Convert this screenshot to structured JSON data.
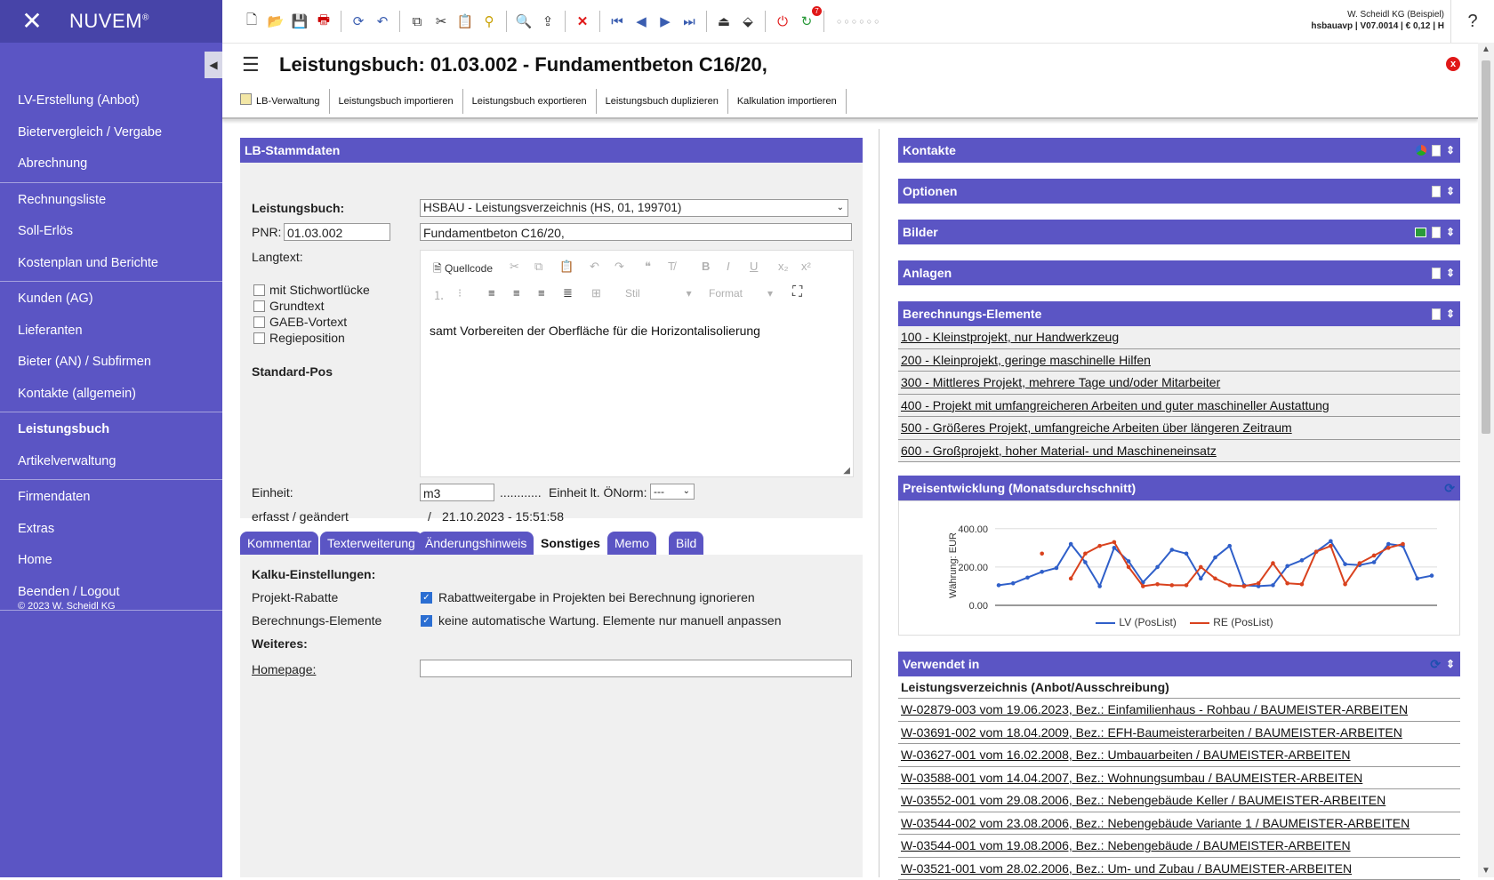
{
  "brand": {
    "name": "NUVEM",
    "reg": "®"
  },
  "sidebar": {
    "groups": [
      [
        "LV-Erstellung (Anbot)",
        "Bietervergleich / Vergabe",
        "Abrechnung"
      ],
      [
        "Rechnungsliste",
        "Soll-Erlös",
        "Kostenplan und Berichte"
      ],
      [
        "Kunden (AG)",
        "Lieferanten",
        "Bieter (AN) / Subfirmen",
        "Kontakte (allgemein)"
      ],
      [
        "Leistungsbuch",
        "Artikelverwaltung"
      ],
      [
        "Firmendaten",
        "Extras",
        "Home",
        "Beenden / Logout"
      ]
    ],
    "active": "Leistungsbuch",
    "copyright": "© 2023 W. Scheidl KG"
  },
  "topbar": {
    "user_line1": "W. Scheidl KG (Beispiel)",
    "user_line2": "hsbauavp | V07.0014 | € 0,12 | H",
    "help": "?",
    "badge": "7",
    "dots": "○○○○○○"
  },
  "title": {
    "text": "Leistungsbuch: 01.03.002 - Fundamentbeton C16/20,",
    "close": "x"
  },
  "subtabs": [
    "LB-Verwaltung",
    "Leistungsbuch importieren",
    "Leistungsbuch exportieren",
    "Leistungsbuch duplizieren",
    "Kalkulation importieren"
  ],
  "stammdaten": {
    "header": "LB-Stammdaten",
    "lb_label": "Leistungsbuch:",
    "lb_value": "HSBAU - Leistungsverzeichnis (HS, 01, 199701)",
    "pnr_label": "PNR:",
    "pnr_value": "01.03.002",
    "kurztext": "Fundamentbeton C16/20,",
    "langtext_label": "Langtext:",
    "checkboxes": [
      "mit Stichwortlücke",
      "Grundtext",
      "GAEB-Vortext",
      "Regieposition"
    ],
    "standard_pos": "Standard-Pos",
    "editor": {
      "source": "Quellcode",
      "style": "Stil",
      "format": "Format",
      "text": "samt Vorbereiten der Oberfläche für die Horizontalisolierung"
    },
    "einheit_label": "Einheit:",
    "einheit_value": "m3",
    "einheit_dots": "............",
    "oenorm_label": "Einheit lt. ÖNorm:",
    "oenorm_value": "---",
    "erfasst_label": "erfasst / geändert",
    "erfasst_sep": "/",
    "erfasst_value": "21.10.2023 - 15:51:58"
  },
  "bottom_tabs": [
    "Kommentar",
    "Texterweiterung",
    "Änderungshinweis",
    "Sonstiges",
    "Memo",
    "Bild"
  ],
  "active_tab": "Sonstiges",
  "sonstiges": {
    "kalku_title": "Kalku-Einstellungen:",
    "projekt_rabatte_label": "Projekt-Rabatte",
    "projekt_rabatte_text": "Rabattweitergabe in Projekten bei Berechnung ignorieren",
    "berechnung_label": "Berechnungs-Elemente",
    "berechnung_text": "keine automatische Wartung. Elemente nur manuell anpassen",
    "weiteres": "Weiteres:",
    "homepage_label": "Homepage:",
    "homepage_value": ""
  },
  "right": {
    "kontakte": "Kontakte",
    "optionen": "Optionen",
    "bilder": "Bilder",
    "anlagen": "Anlagen",
    "berechnungs_header": "Berechnungs-Elemente",
    "berechnungs": [
      "100 - Kleinstprojekt, nur Handwerkzeug",
      "200 - Kleinprojekt, geringe maschinelle Hilfen",
      "300 - Mittleres Projekt, mehrere Tage und/oder Mitarbeiter",
      "400 - Projekt mit umfangreicheren Arbeiten und guter maschineller Austattung",
      "500 - Größeres Projekt, umfangreiche Arbeiten über längeren Zeitraum",
      "600 - Großprojekt, hoher Material- und Maschineneinsatz"
    ],
    "preis_header": "Preisentwicklung (Monatsdurchschnitt)",
    "verwendet_header": "Verwendet in",
    "verwendet_sub": "Leistungsverzeichnis (Anbot/Ausschreibung)",
    "verwendet": [
      "W-02879-003 vom 19.06.2023, Bez.: Einfamilienhaus - Rohbau / BAUMEISTER-ARBEITEN",
      "W-03691-002 vom 18.04.2009, Bez.: EFH-Baumeisterarbeiten / BAUMEISTER-ARBEITEN",
      "W-03627-001 vom 16.02.2008, Bez.: Umbauarbeiten / BAUMEISTER-ARBEITEN",
      "W-03588-001 vom 14.04.2007, Bez.: Wohnungsumbau / BAUMEISTER-ARBEITEN",
      "W-03552-001 vom 29.08.2006, Bez.: Nebengebäude Keller / BAUMEISTER-ARBEITEN",
      "W-03544-002 vom 23.08.2006, Bez.: Nebengebäude Variante 1 / BAUMEISTER-ARBEITEN",
      "W-03544-001 vom 19.08.2006, Bez.: Nebengebäude / BAUMEISTER-ARBEITEN",
      "W-03521-001 vom 28.02.2006, Bez.: Um- und Zubau / BAUMEISTER-ARBEITEN"
    ]
  },
  "colors": {
    "sidebar": "#5b55c4",
    "panel_header": "#5b55c4",
    "lv": "#2f5fc9",
    "re": "#d9421e"
  },
  "chart_data": {
    "type": "line",
    "ylabel": "Währung: EUR",
    "yticks": [
      "400.00",
      "200.00",
      "0.00"
    ],
    "ylim": [
      0,
      450
    ],
    "grid": true,
    "legend_position": "bottom",
    "series": [
      {
        "name": "LV (PosList)",
        "color": "#2f5fc9",
        "values": [
          105,
          115,
          145,
          175,
          195,
          320,
          225,
          100,
          300,
          230,
          120,
          200,
          290,
          270,
          140,
          250,
          310,
          105,
          100,
          105,
          205,
          235,
          280,
          335,
          215,
          210,
          225,
          320,
          310,
          140,
          155
        ]
      },
      {
        "name": "RE (PosList)",
        "color": "#d9421e",
        "values": [
          null,
          null,
          null,
          270,
          null,
          140,
          270,
          310,
          330,
          200,
          100,
          110,
          105,
          105,
          200,
          140,
          105,
          100,
          115,
          220,
          115,
          110,
          280,
          310,
          110,
          220,
          260,
          300,
          320,
          null,
          null
        ]
      }
    ]
  }
}
